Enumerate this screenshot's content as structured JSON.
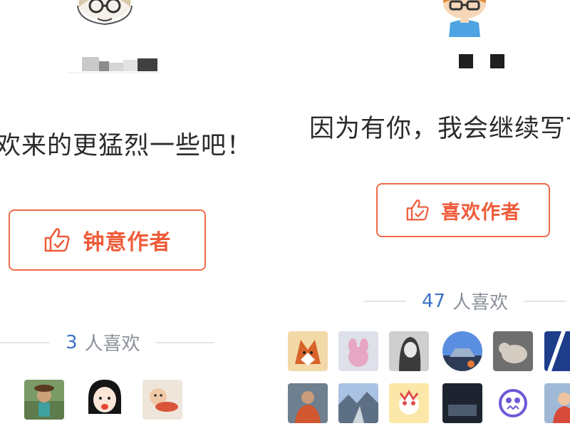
{
  "left_card": {
    "slogan": "欢来的更猛烈一些吧！",
    "button_label": "钟意作者",
    "likes_count": "3",
    "likes_suffix": "人喜欢",
    "icons": {
      "avatar": "cartoon-avatar-glasses-icon",
      "thumb": "thumbs-up-icon"
    },
    "likers": [
      {
        "name": "liker-avatar-1",
        "colors": [
          "#6b8f5a",
          "#c9b07a"
        ]
      },
      {
        "name": "liker-avatar-2",
        "colors": [
          "#fce3d3",
          "#1a1a1a"
        ]
      },
      {
        "name": "liker-avatar-3",
        "colors": [
          "#e9dccc",
          "#d46a4a"
        ]
      }
    ]
  },
  "right_card": {
    "slogan": "因为有你，我会继续写下",
    "button_label": "喜欢作者",
    "likes_count": "47",
    "likes_suffix": "人喜欢",
    "icons": {
      "avatar": "cartoon-avatar-orange-hair-icon",
      "thumb": "thumbs-up-icon"
    },
    "likers": [
      {
        "name": "liker-avatar-fox",
        "colors": [
          "#e8a35a",
          "#c2582a"
        ]
      },
      {
        "name": "liker-avatar-pink-toy",
        "colors": [
          "#d9dce6",
          "#e6a9c3"
        ]
      },
      {
        "name": "liker-avatar-portrait",
        "colors": [
          "#bdbdbd",
          "#3b3b3b"
        ]
      },
      {
        "name": "liker-avatar-car",
        "colors": [
          "#4a7bd1",
          "#2d3b57"
        ]
      },
      {
        "name": "liker-avatar-cat",
        "colors": [
          "#777777",
          "#cfc7bd"
        ]
      },
      {
        "name": "liker-avatar-blue-logo",
        "colors": [
          "#1d3d8a",
          "#ffffff"
        ]
      },
      {
        "name": "liker-avatar-man",
        "colors": [
          "#6b7b8a",
          "#d0572f"
        ]
      },
      {
        "name": "liker-avatar-landscape",
        "colors": [
          "#9cb4d8",
          "#5d6f85"
        ]
      },
      {
        "name": "liker-avatar-cartoon",
        "colors": [
          "#f7d55e",
          "#e24b4b"
        ]
      },
      {
        "name": "liker-avatar-dark",
        "colors": [
          "#1d2430",
          "#4d5b70"
        ]
      },
      {
        "name": "liker-avatar-monster",
        "colors": [
          "#ffffff",
          "#6c5ad6"
        ]
      },
      {
        "name": "liker-avatar-child",
        "colors": [
          "#9fb8d6",
          "#d84b3b"
        ]
      }
    ]
  },
  "colors": {
    "accent": "#ee5b3a",
    "count_blue": "#3c74c7",
    "muted": "#8a8f9a",
    "text": "#2b2b2b"
  }
}
